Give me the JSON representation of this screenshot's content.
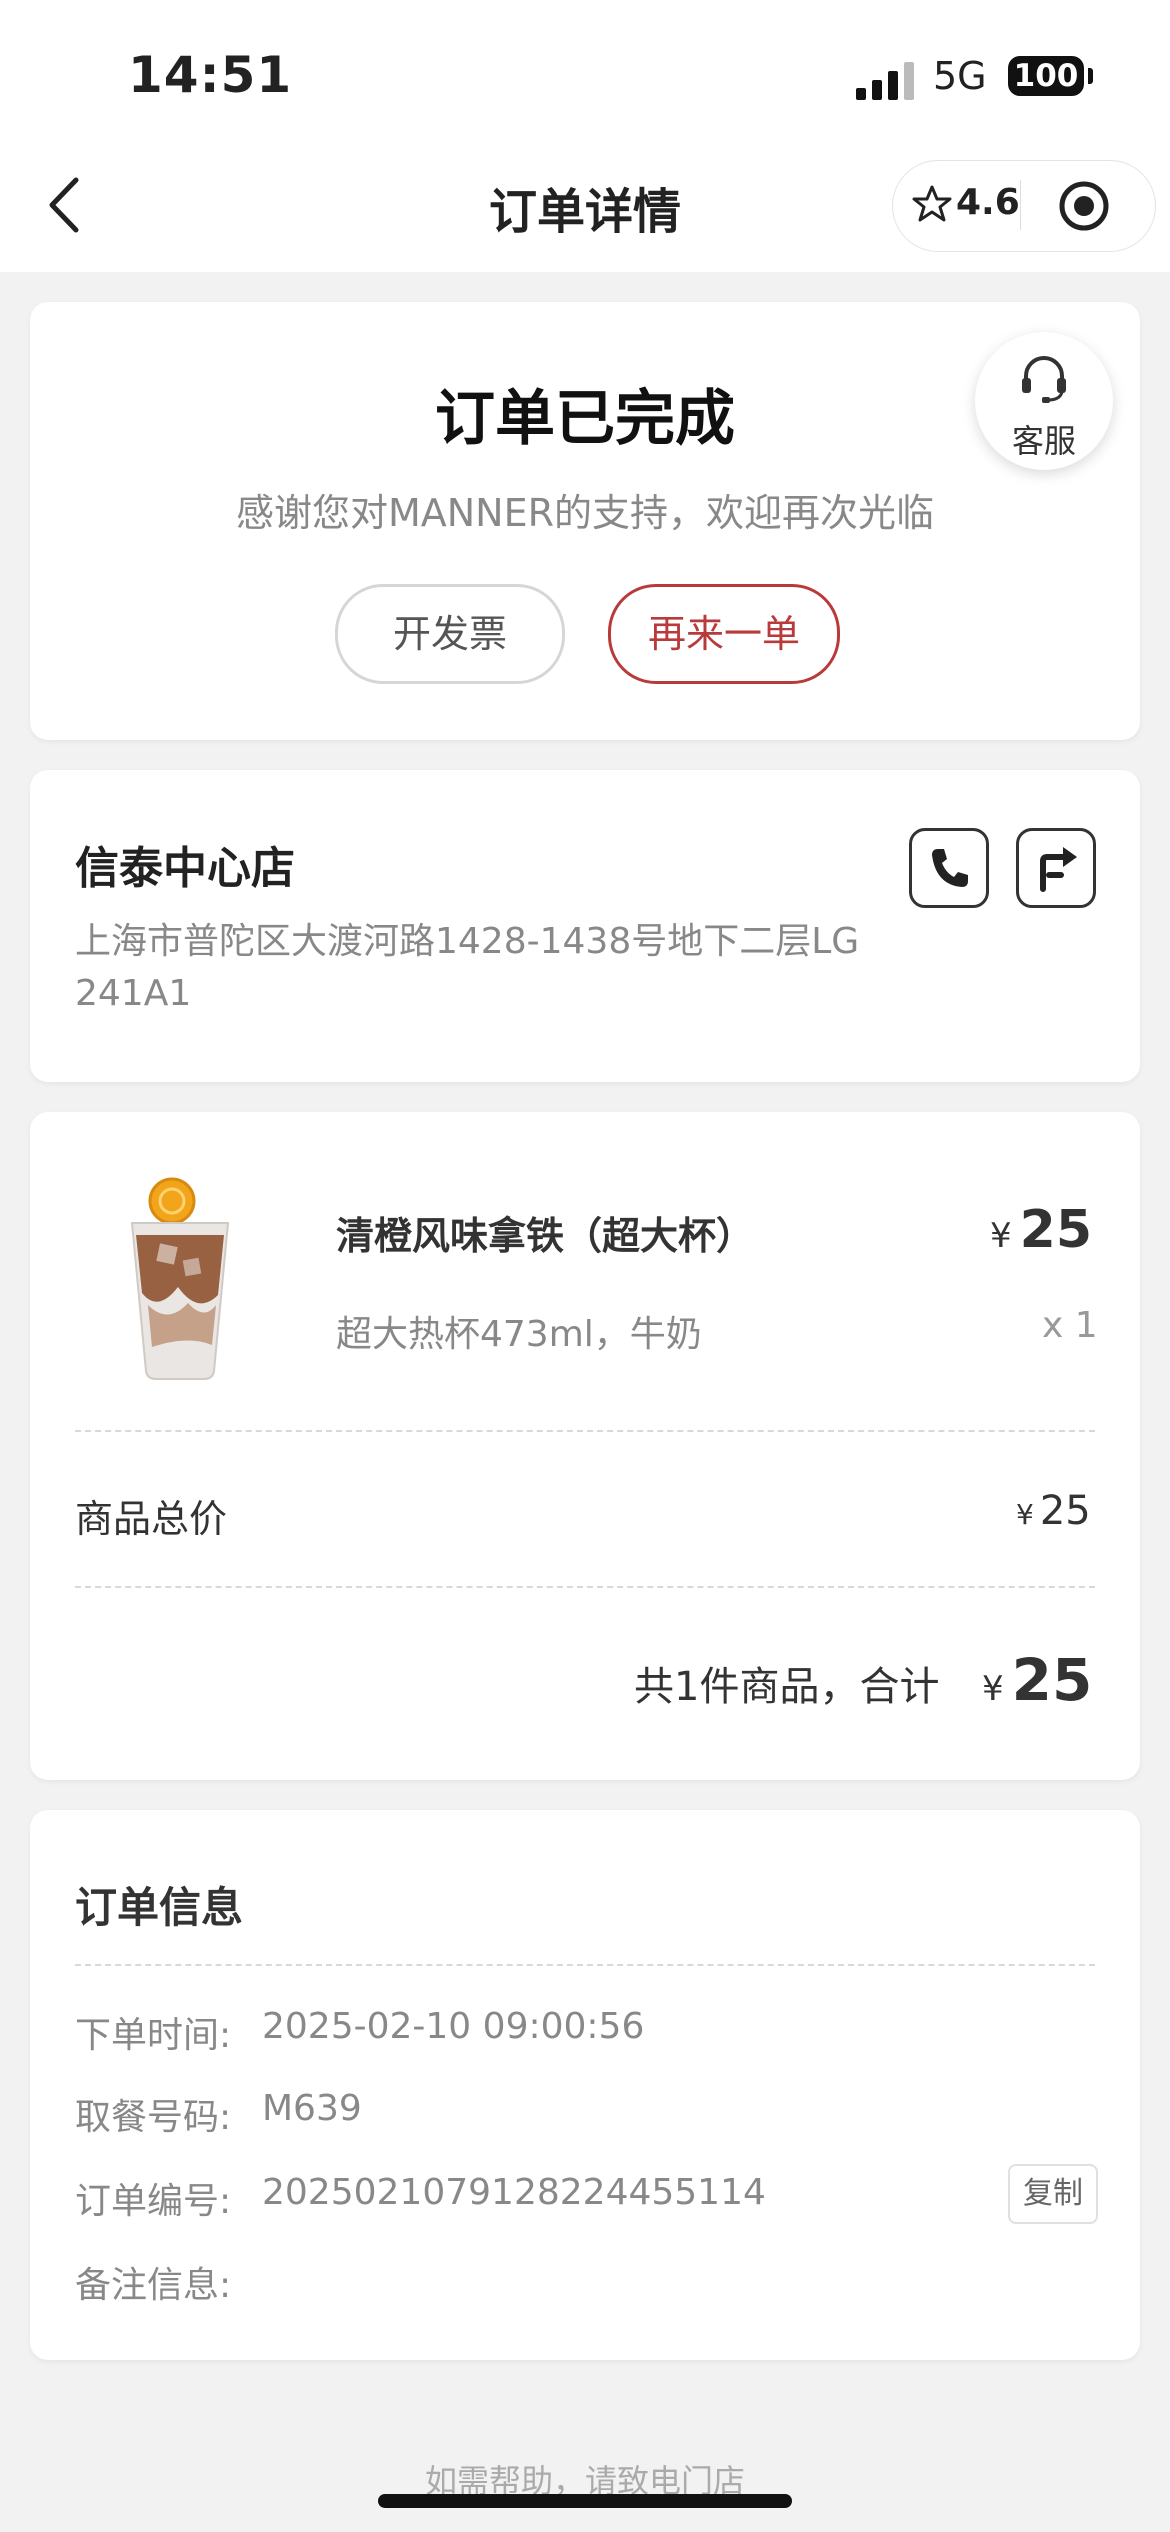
{
  "status_bar": {
    "time": "14:51",
    "network": "5G",
    "battery": "100"
  },
  "nav": {
    "title": "订单详情",
    "rating": "4.6"
  },
  "status": {
    "title": "订单已完成",
    "subtitle": "感谢您对MANNER的支持，欢迎再次光临",
    "invoice_button": "开发票",
    "reorder_button": "再来一单",
    "customer_service": "客服"
  },
  "store": {
    "name": "信泰中心店",
    "address": "上海市普陀区大渡河路1428-1438号地下二层LG 241A1"
  },
  "order": {
    "item": {
      "name": "清橙风味拿铁（超大杯）",
      "currency": "¥",
      "price": "25",
      "spec": "超大热杯473ml，牛奶",
      "quantity": "x 1"
    },
    "subtotal_label": "商品总价",
    "subtotal_currency": "¥",
    "subtotal_value": "25",
    "summary_text": "共1件商品，合计",
    "total_currency": "¥",
    "total_value": "25"
  },
  "info": {
    "title": "订单信息",
    "order_time_label": "下单时间:",
    "order_time": "2025-02-10 09:00:56",
    "pickup_label": "取餐号码:",
    "pickup_code": "M639",
    "order_no_label": "订单编号:",
    "order_no": "2025021079128224455114",
    "copy_button": "复制",
    "remark_label": "备注信息:"
  },
  "footer": {
    "help": "如需帮助，请致电门店"
  },
  "colors": {
    "accent": "#b83a3a",
    "background": "#f3f2f2"
  }
}
